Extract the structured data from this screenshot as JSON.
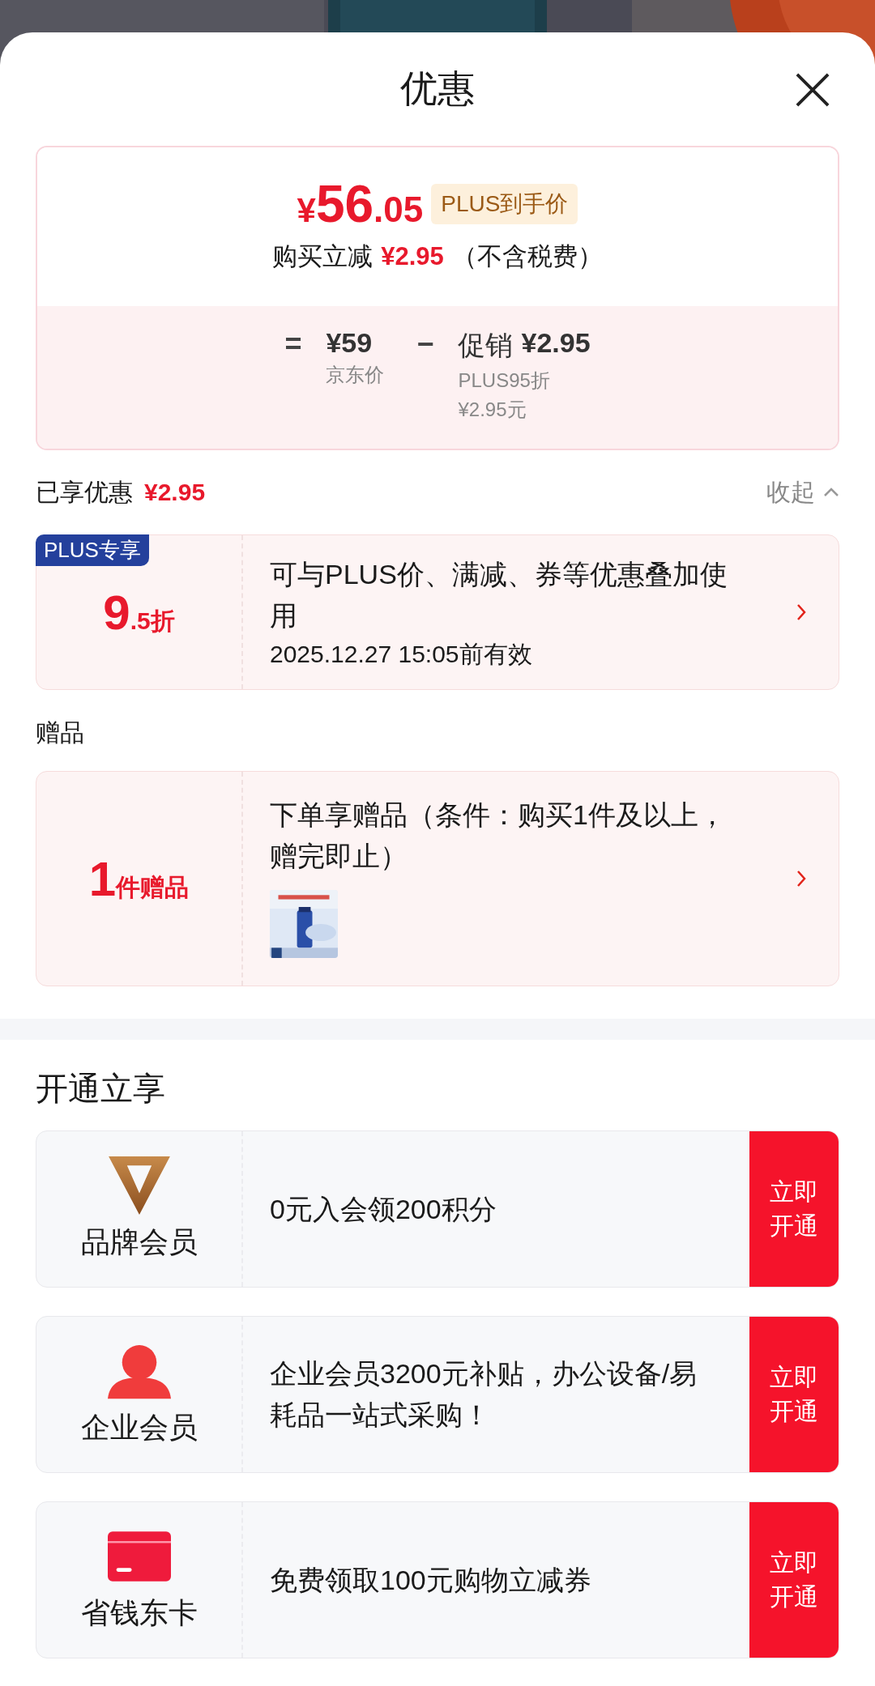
{
  "header": {
    "title": "优惠"
  },
  "price_summary": {
    "final_price": {
      "symbol": "¥",
      "integer": "56",
      "decimal": ".05"
    },
    "badge": "PLUS到手价",
    "reduction_label": "购买立减",
    "reduction_amount": "¥2.95",
    "reduction_note": "（不含税费）",
    "breakdown": [
      {
        "operator": "=",
        "amount": "¥59",
        "labels": [
          "京东价"
        ]
      },
      {
        "operator": "−",
        "prefix": "促销",
        "amount": "¥2.95",
        "labels": [
          "PLUS95折",
          "¥2.95元"
        ]
      }
    ]
  },
  "discounts": {
    "label": "已享优惠",
    "amount": "¥2.95",
    "toggle": "收起",
    "expanded": true
  },
  "coupons": [
    {
      "tag": "PLUS专享",
      "value_big": "9",
      "value_small": ".5折",
      "description": "可与PLUS价、满减、券等优惠叠加使用",
      "validity": "2025.12.27 15:05前有效"
    }
  ],
  "gifts": {
    "label": "赠品",
    "items": [
      {
        "value_big": "1",
        "value_small": "件赠品",
        "description": "下单享赠品（条件：购买1件及以上，赠完即止）"
      }
    ]
  },
  "memberships": {
    "title": "开通立享",
    "items": [
      {
        "kind": "brand",
        "name": "品牌会员",
        "description": "0元入会领200积分",
        "button": "立即开通"
      },
      {
        "kind": "person",
        "name": "企业会员",
        "description": "企业会员3200元补贴，办公设备/易耗品一站式采购！",
        "button": "立即开通"
      },
      {
        "kind": "card",
        "name": "省钱东卡",
        "description": "免费领取100元购物立减券",
        "button": "立即开通"
      }
    ]
  }
}
